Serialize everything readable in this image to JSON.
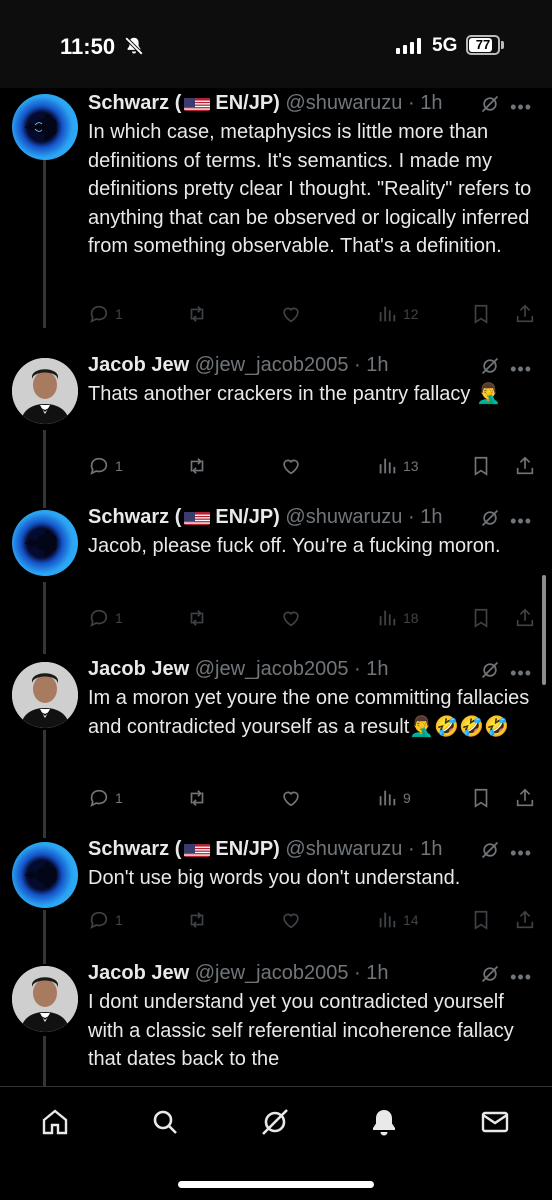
{
  "status_bar": {
    "time": "11:50",
    "network": "5G",
    "battery": "77",
    "battery_level": 0.77
  },
  "posts": [
    {
      "author": "Schwarz (",
      "flag": "🇺🇸",
      "author_suffix": "EN/JP)",
      "handle": "@shuwaruzu",
      "time": "· 1h",
      "text": "In which case, metaphysics is little more than definitions of terms. It's semantics. I made my definitions pretty clear I thought. \"Reality\" refers to anything that can be observed or logically inferred from something observable. That's a definition.",
      "replies": "1",
      "reposts": "",
      "likes": "",
      "views": "12",
      "avatar": "fractal-avatar"
    },
    {
      "author": "Jacob Jew",
      "handle": "@jew_jacob2005",
      "time": "· 1h",
      "text": "Thats another crackers in the pantry fallacy 🤦‍♂️",
      "replies": "1",
      "reposts": "",
      "likes": "",
      "views": "13",
      "avatar": "tuxedo-avatar"
    },
    {
      "author": "Schwarz (",
      "flag": "🇺🇸",
      "author_suffix": "EN/JP)",
      "handle": "@shuwaruzu",
      "time": "· 1h",
      "text": "Jacob, please fuck off. You're a fucking moron.",
      "replies": "1",
      "reposts": "",
      "likes": "",
      "views": "18",
      "avatar": "fractal-avatar"
    },
    {
      "author": "Jacob Jew",
      "handle": "@jew_jacob2005",
      "time": "· 1h",
      "text": "Im a moron yet youre the one committing fallacies and contradicted yourself as a result🤦‍♂️🤣🤣🤣",
      "replies": "1",
      "reposts": "",
      "likes": "",
      "views": "9",
      "avatar": "tuxedo-avatar"
    },
    {
      "author": "Schwarz (",
      "flag": "🇺🇸",
      "author_suffix": "EN/JP)",
      "handle": "@shuwaruzu",
      "time": "· 1h",
      "text": "Don't use big words you don't understand.",
      "replies": "1",
      "reposts": "",
      "likes": "",
      "views": "14",
      "avatar": "fractal-avatar"
    },
    {
      "author": "Jacob Jew",
      "handle": "@jew_jacob2005",
      "time": "· 1h",
      "text": "I dont understand yet you contradicted yourself with a classic self referential incoherence fallacy that dates back to the",
      "replies": "",
      "reposts": "",
      "likes": "",
      "views": "",
      "avatar": "tuxedo-avatar"
    }
  ],
  "tab_bar": [
    "home-icon",
    "search-icon",
    "grok-icon",
    "notifications-icon",
    "messages-icon"
  ],
  "colors": {
    "background": "#000000",
    "text": "#e7e9ea",
    "muted": "#71767b",
    "divider": "#2f3336"
  }
}
